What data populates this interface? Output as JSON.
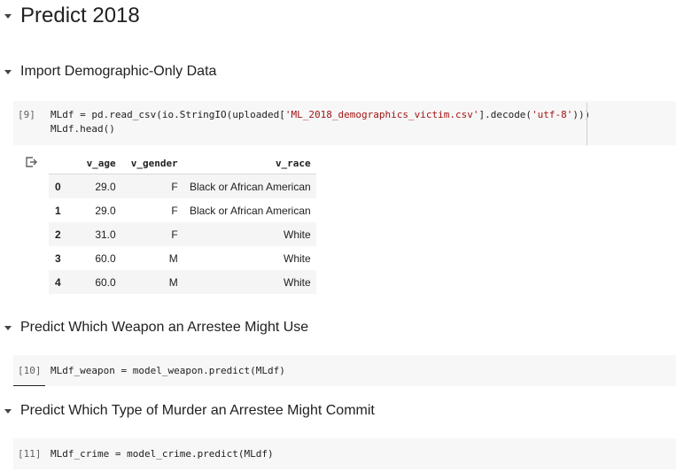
{
  "headings": {
    "h1": "Predict 2018",
    "import": "Import Demographic-Only Data",
    "weapon": "Predict Which Weapon an Arrestee Might Use",
    "murder": "Predict Which Type of Murder an Arrestee Might Commit"
  },
  "cells": [
    {
      "count": "[9]",
      "line1_a": "MLdf = pd.read_csv(io.StringIO(uploaded[",
      "line1_str1": "'ML_2018_demographics_victim.csv'",
      "line1_b": "].decode(",
      "line1_str2": "'utf-8'",
      "line1_c": ")))",
      "line2": "MLdf.head()"
    },
    {
      "count": "[10]",
      "line1": "MLdf_weapon = model_weapon.predict(MLdf)"
    },
    {
      "count": "[11]",
      "line1": "MLdf_crime = model_crime.predict(MLdf)"
    }
  ],
  "output_icon": "output-arrow-icon",
  "table": {
    "columns": [
      "",
      "v_age",
      "v_gender",
      "v_race"
    ],
    "rows": [
      [
        "0",
        "29.0",
        "F",
        "Black or African American"
      ],
      [
        "1",
        "29.0",
        "F",
        "Black or African American"
      ],
      [
        "2",
        "31.0",
        "F",
        "White"
      ],
      [
        "3",
        "60.0",
        "M",
        "White"
      ],
      [
        "4",
        "60.0",
        "M",
        "White"
      ]
    ]
  },
  "colors": {
    "cell_background": "#f7f7f7",
    "string_literal": "#a31515",
    "row_stripe": "#f5f5f5"
  }
}
